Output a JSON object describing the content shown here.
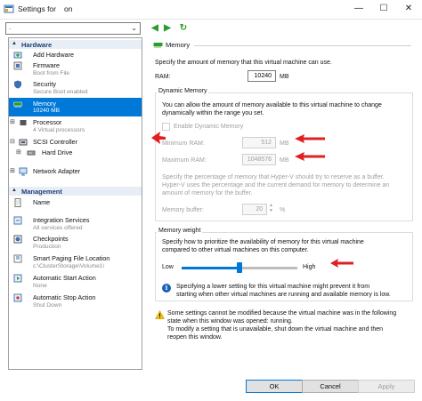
{
  "window": {
    "title": "Settings for   on",
    "controls": [
      "—",
      "☐",
      "✕"
    ]
  },
  "toolbar": {
    "vm_selector_value": ".",
    "back_glyph": "◀",
    "forward_glyph": "▶",
    "refresh_glyph": "↻"
  },
  "sidebar": {
    "hardware_header": "Hardware",
    "management_header": "Management",
    "hardware_items": [
      {
        "label": "Add Hardware",
        "sub": ""
      },
      {
        "label": "Firmware",
        "sub": "Boot from File"
      },
      {
        "label": "Security",
        "sub": "Secure Boot enabled"
      },
      {
        "label": "Memory",
        "sub": "10240 MB"
      },
      {
        "label": "Processor",
        "sub": "4 Virtual processors"
      },
      {
        "label": "SCSI Controller",
        "sub": ""
      },
      {
        "label": "Hard Drive",
        "sub": ""
      },
      {
        "label": "Network Adapter",
        "sub": ""
      }
    ],
    "management_items": [
      {
        "label": "Name",
        "sub": ""
      },
      {
        "label": "Integration Services",
        "sub": "All services offered"
      },
      {
        "label": "Checkpoints",
        "sub": "Production"
      },
      {
        "label": "Smart Paging File Location",
        "sub": "c:\\ClusterStorage\\Volume1\\"
      },
      {
        "label": "Automatic Start Action",
        "sub": "None"
      },
      {
        "label": "Automatic Stop Action",
        "sub": "Shut Down"
      }
    ]
  },
  "memory": {
    "header": "Memory",
    "intro": "Specify the amount of memory that this virtual machine can use.",
    "ram_label": "RAM:",
    "ram_value": "10240",
    "ram_unit": "MB",
    "dynamic": {
      "title": "Dynamic Memory",
      "description_line1": "You can allow the amount of memory available to this virtual machine to change",
      "description_line2": "dynamically within the range you set.",
      "enable_label": "Enable Dynamic Memory",
      "enabled": false,
      "min_label": "Minimum RAM:",
      "min_value": "512",
      "min_unit": "MB",
      "max_label": "Maximum RAM:",
      "max_value": "1048576",
      "max_unit": "MB",
      "buffer_desc_line1": "Specify the percentage of memory that Hyper-V should try to reserve as a buffer.",
      "buffer_desc_line2": "Hyper-V uses the percentage and the current demand for memory to determine an",
      "buffer_desc_line3": "amount of memory for the buffer.",
      "buffer_label": "Memory buffer:",
      "buffer_value": "20",
      "buffer_unit": "%"
    },
    "weight": {
      "title": "Memory weight",
      "desc_line1": "Specify how to prioritize the availability of memory for this virtual machine",
      "desc_line2": "compared to other virtual machines on this computer.",
      "low_label": "Low",
      "high_label": "High",
      "slider_value": 0.5,
      "info_line1": "Specifying a lower setting for this virtual machine might prevent it from",
      "info_line2": "starting when other virtual machines are running and available memory is low."
    },
    "warning_line1": "Some settings cannot be modified because the virtual machine was in the following",
    "warning_line2": "state when this window was opened: running.",
    "warning_line3": "To modify a setting that is unavailable, shut down the virtual machine and then",
    "warning_line4": "reopen this window."
  },
  "buttons": {
    "ok": "OK",
    "cancel": "Cancel",
    "apply": "Apply"
  },
  "colors": {
    "selection": "#0078d7",
    "annotation_arrow": "#e02020",
    "section_header_text": "#1c3f74"
  }
}
